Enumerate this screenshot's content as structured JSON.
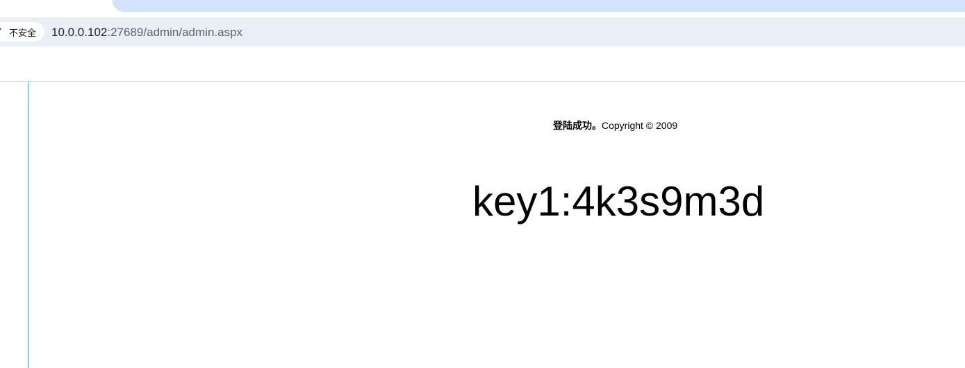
{
  "browser": {
    "security_label": "不安全",
    "url_host": "10.0.0.102",
    "url_rest": ":27689/admin/admin.aspx"
  },
  "page": {
    "login_status": "登陆成功。",
    "copyright": "Copyright © 2009",
    "key": "key1:4k3s9m3d"
  },
  "colors": {
    "active_tab": "#d3e3fd",
    "toolbar": "#e9eef7",
    "frame_divider": "#5a9bd5"
  }
}
